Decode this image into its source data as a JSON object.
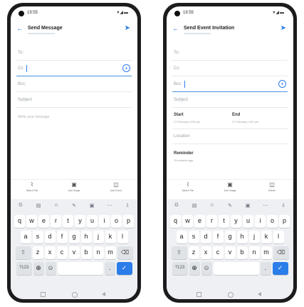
{
  "status": {
    "time": "19:55",
    "icons": "▾◢▬"
  },
  "keyboard_keys": {
    "tools": [
      "G",
      "▤",
      "☺",
      "✎",
      "▣",
      "⋯",
      "⇩"
    ],
    "row1": [
      "q",
      "w",
      "e",
      "r",
      "t",
      "y",
      "u",
      "i",
      "o",
      "p"
    ],
    "row2": [
      "a",
      "s",
      "d",
      "f",
      "g",
      "h",
      "j",
      "k",
      "l"
    ],
    "row3": [
      "z",
      "x",
      "c",
      "v",
      "b",
      "n",
      "m"
    ],
    "shift": "⇧",
    "backspace": "⌫",
    "symbols": "?123",
    "globe": "⊕",
    "emoji": "☺",
    "enter": "✓"
  },
  "screen1": {
    "title": "Send Message",
    "to_label": "To:",
    "cc_label": "Cc:",
    "bcc_label": "Bcc:",
    "subject_placeholder": "Subject",
    "body_placeholder": "Write your message",
    "attachments": [
      "Attach File",
      "Add Image",
      "Add Event"
    ]
  },
  "screen2": {
    "title": "Send Event Invitation",
    "to_label": "To:",
    "cc_label": "Cc:",
    "bcc_label": "Bcc:",
    "subject_placeholder": "Subject",
    "start_label": "Start",
    "start_value": "27 February 3:00 pm",
    "end_label": "End",
    "end_value": "27 February 4:00 pm",
    "location_placeholder": "Location",
    "reminder_label": "Reminder",
    "reminder_value": "15 minutes ago",
    "attachments": [
      "Attach File",
      "Add Image",
      "Delete"
    ]
  }
}
